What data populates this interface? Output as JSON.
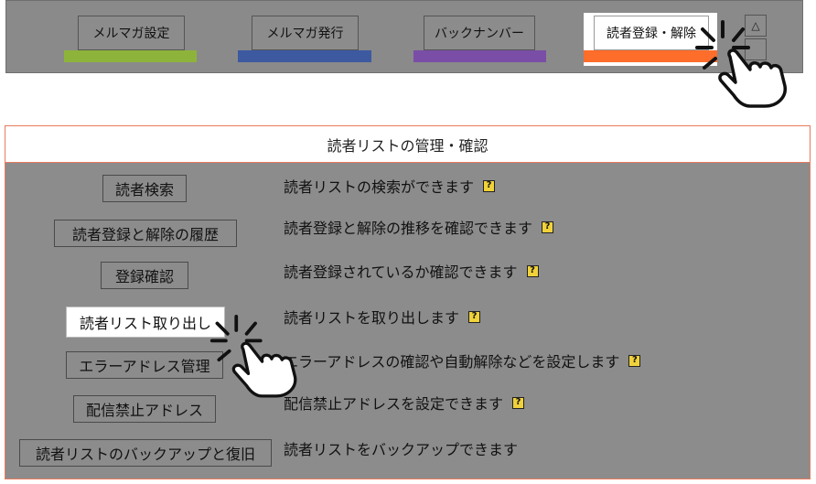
{
  "tabs": [
    {
      "label": "メルマガ設定",
      "color": "#8db33a"
    },
    {
      "label": "メルマガ発行",
      "color": "#3d5aa1"
    },
    {
      "label": "バックナンバー",
      "color": "#7a4ea6"
    },
    {
      "label": "読者登録・解除",
      "color": "#ff6d2a",
      "active": true
    }
  ],
  "scroll_up_glyph": "△",
  "panel": {
    "title": "読者リストの管理・確認",
    "items": [
      {
        "button": "読者検索",
        "desc": "読者リストの検索ができます",
        "help": "?"
      },
      {
        "button": "読者登録と解除の履歴",
        "desc": "読者登録と解除の推移を確認できます",
        "help": "?"
      },
      {
        "button": "登録確認",
        "desc": "読者登録されているか確認できます",
        "help": "?"
      },
      {
        "button": "読者リスト取り出し",
        "desc": "読者リストを取り出します",
        "help": "?",
        "highlighted": true
      },
      {
        "button": "エラーアドレス管理",
        "desc": "エラーアドレスの確認や自動解除などを設定します",
        "help": "?"
      },
      {
        "button": "配信禁止アドレス",
        "desc": "配信禁止アドレスを設定できます",
        "help": "?"
      },
      {
        "button": "読者リストのバックアップと復旧",
        "desc": "読者リストをバックアップできます"
      }
    ]
  },
  "icons": {
    "pointer": "hand-pointer-click-icon",
    "help": "help-icon"
  }
}
